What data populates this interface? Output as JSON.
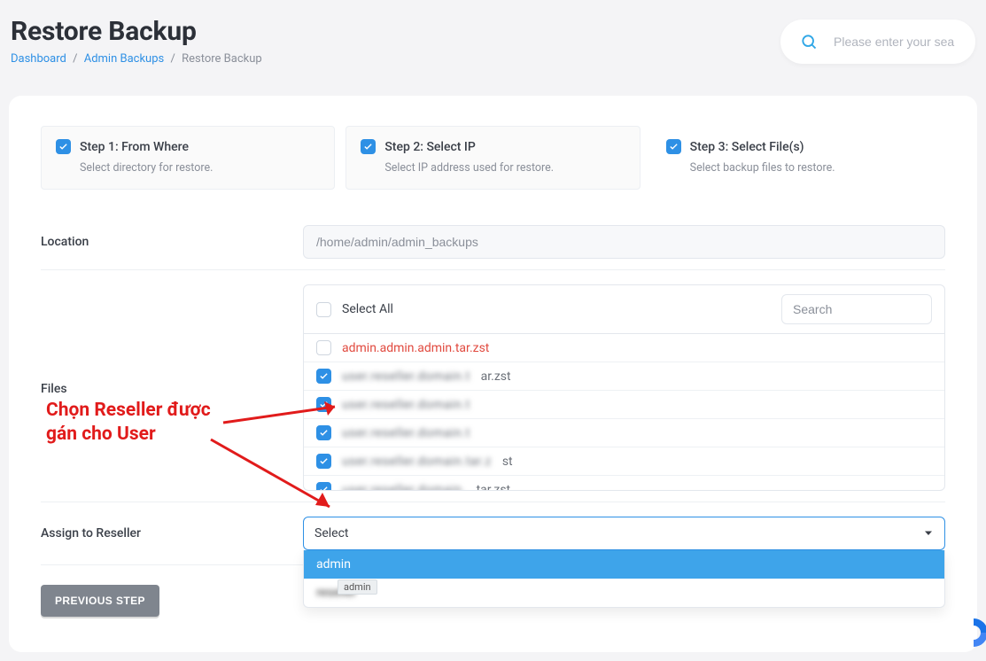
{
  "header": {
    "page_title": "Restore Backup",
    "search_placeholder": "Please enter your sea"
  },
  "breadcrumb": {
    "items": [
      {
        "label": "Dashboard",
        "link": true
      },
      {
        "label": "Admin Backups",
        "link": true
      },
      {
        "label": "Restore Backup",
        "link": false
      }
    ],
    "separator": "/"
  },
  "steps": [
    {
      "title": "Step 1: From Where",
      "subtitle": "Select directory for restore.",
      "checked": true,
      "active": false
    },
    {
      "title": "Step 2: Select IP",
      "subtitle": "Select IP address used for restore.",
      "checked": true,
      "active": false
    },
    {
      "title": "Step 3: Select File(s)",
      "subtitle": "Select backup files to restore.",
      "checked": true,
      "active": true
    }
  ],
  "location": {
    "label": "Location",
    "value": "/home/admin/admin_backups"
  },
  "files": {
    "label": "Files",
    "select_all_label": "Select All",
    "select_all_checked": false,
    "search_placeholder": "Search",
    "rows": [
      {
        "checked": false,
        "name": "admin.admin.admin.tar.zst",
        "highlight": true,
        "obscured": false,
        "suffix": ""
      },
      {
        "checked": true,
        "name": "",
        "highlight": false,
        "obscured": true,
        "suffix": "ar.zst"
      },
      {
        "checked": true,
        "name": "",
        "highlight": false,
        "obscured": true,
        "suffix": ""
      },
      {
        "checked": true,
        "name": "",
        "highlight": false,
        "obscured": true,
        "suffix": ""
      },
      {
        "checked": true,
        "name": "",
        "highlight": false,
        "obscured": true,
        "suffix": "st"
      },
      {
        "checked": true,
        "name": "",
        "highlight": false,
        "obscured": true,
        "suffix": "tar.zst"
      }
    ]
  },
  "assign": {
    "label": "Assign to Reseller",
    "selected": "Select",
    "options": [
      {
        "label": "admin",
        "hover": true,
        "obscured": false
      },
      {
        "label": "",
        "hover": false,
        "obscured": true
      }
    ],
    "tooltip": "admin"
  },
  "buttons": {
    "previous": "PREVIOUS STEP"
  },
  "annotation": {
    "line1": "Chọn Reseller được",
    "line2": "gán cho User"
  },
  "colors": {
    "accent": "#2e90e5",
    "danger": "#e14a3f",
    "annotation": "#e11b1b"
  }
}
